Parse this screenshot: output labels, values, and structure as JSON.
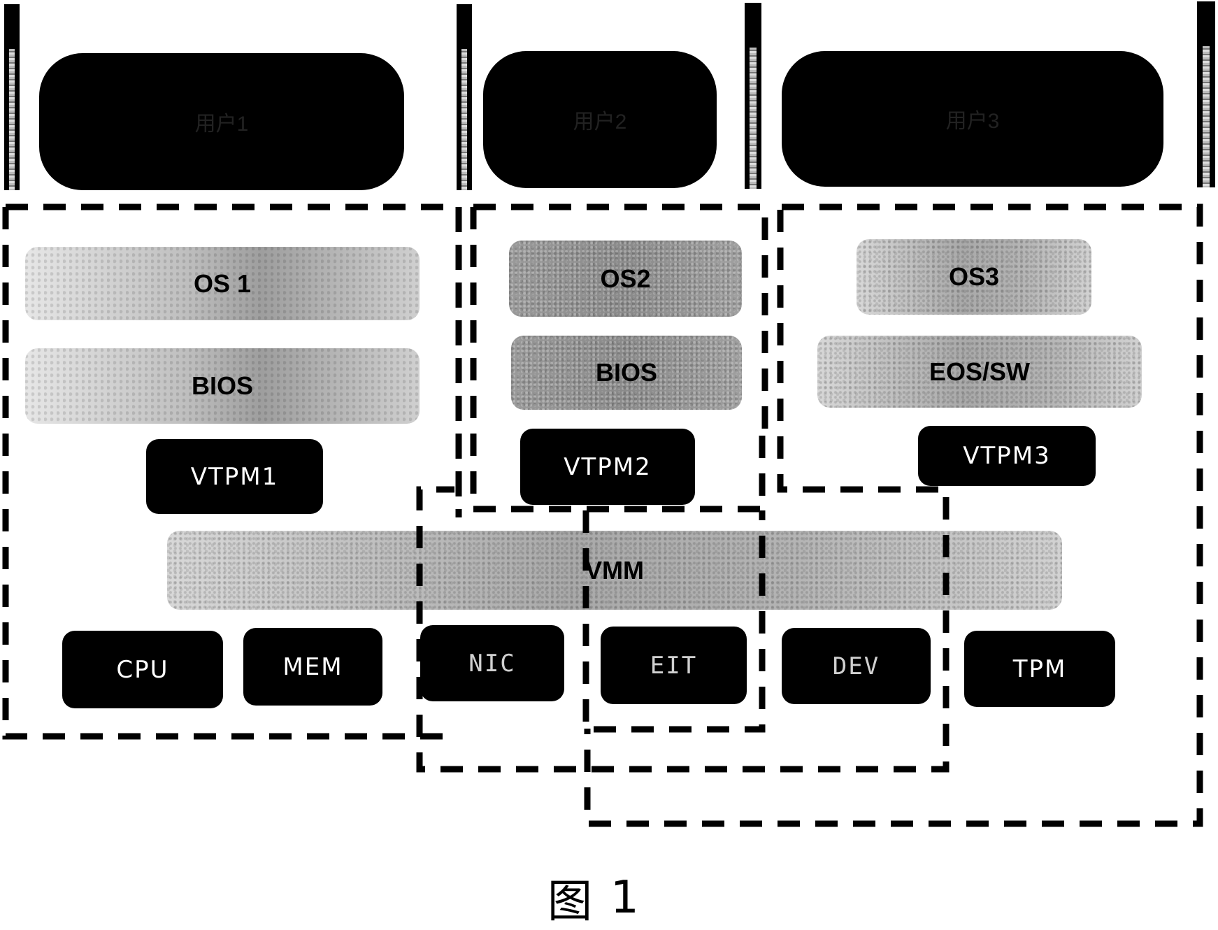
{
  "users": [
    {
      "label": "用户1"
    },
    {
      "label": "用户2"
    },
    {
      "label": "用户3"
    }
  ],
  "guest_layers": {
    "vm1": {
      "os": "OS 1",
      "firmware": "BIOS",
      "vtpm": "VTPM1"
    },
    "vm2": {
      "os": "OS2",
      "firmware": "BIOS",
      "vtpm": "VTPM2"
    },
    "vm3": {
      "os": "OS3",
      "firmware": "EOS/SW",
      "vtpm": "VTPM3"
    }
  },
  "vmm": {
    "label": "VMM"
  },
  "hardware": [
    {
      "label": "CPU"
    },
    {
      "label": "MEM"
    },
    {
      "label": "NIC"
    },
    {
      "label": "EIT"
    },
    {
      "label": "DEV"
    },
    {
      "label": "TPM"
    }
  ],
  "caption": {
    "prefix": "图",
    "number": "1"
  },
  "colors": {
    "block": "#000000",
    "layer_gray": "#a9a9a9",
    "line": "#000000",
    "background": "#ffffff"
  }
}
